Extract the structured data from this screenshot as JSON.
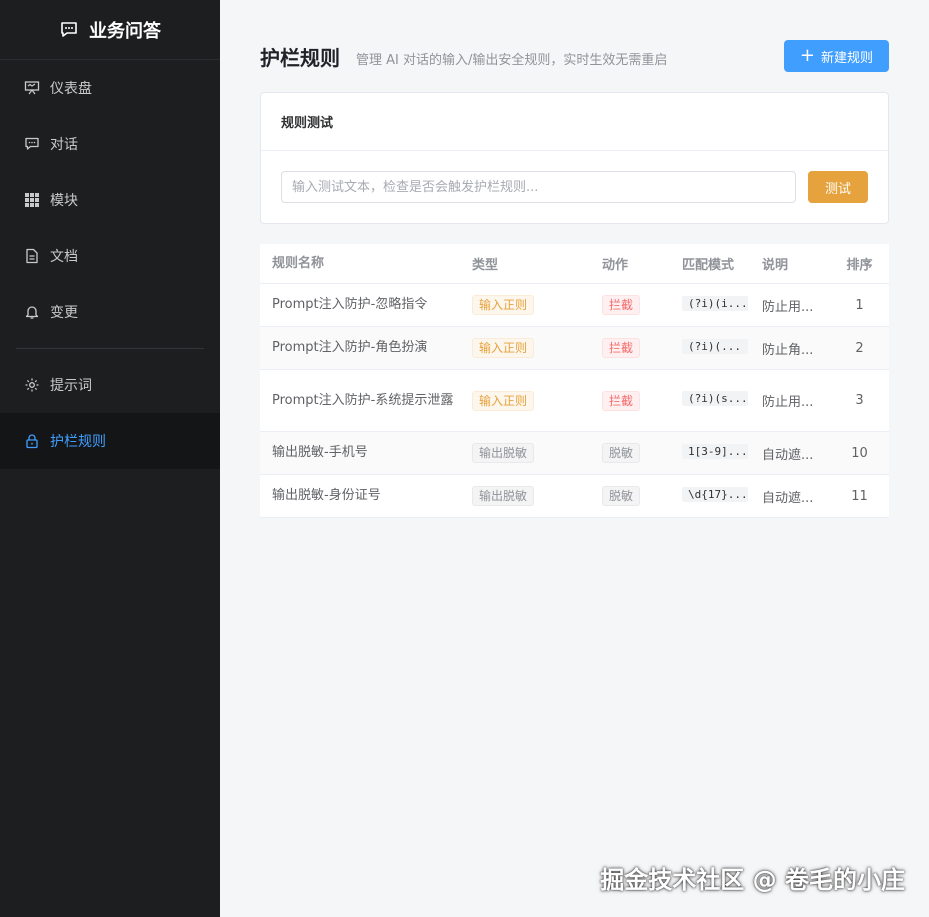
{
  "brand": {
    "title": "业务问答",
    "icon": "chat-icon"
  },
  "sidebar": {
    "items": [
      {
        "label": "仪表盘",
        "icon": "presentation-icon"
      },
      {
        "label": "对话",
        "icon": "chat-icon"
      },
      {
        "label": "模块",
        "icon": "grid-icon"
      },
      {
        "label": "文档",
        "icon": "document-icon"
      },
      {
        "label": "变更",
        "icon": "bell-icon"
      },
      {
        "label": "提示词",
        "icon": "gear-icon"
      },
      {
        "label": "护栏规则",
        "icon": "lock-icon",
        "active": true
      }
    ]
  },
  "page": {
    "title": "护栏规则",
    "description": "管理 AI 对话的输入/输出安全规则，实时生效无需重启",
    "new_button": "新建规则"
  },
  "test_card": {
    "title": "规则测试",
    "placeholder": "输入测试文本，检查是否会触发护栏规则...",
    "button": "测试"
  },
  "table": {
    "headers": [
      "规则名称",
      "类型",
      "动作",
      "匹配模式",
      "说明",
      "排序"
    ],
    "rows": [
      {
        "name": "Prompt注入防护-忽略指令",
        "type": "输入正则",
        "action": "拦截",
        "pattern": "(?i)(i...",
        "desc": "防止用...",
        "order": "1"
      },
      {
        "name": "Prompt注入防护-角色扮演",
        "type": "输入正则",
        "action": "拦截",
        "pattern": "(?i)(...",
        "desc": "防止角...",
        "order": "2"
      },
      {
        "name": "Prompt注入防护-系统提示泄露",
        "type": "输入正则",
        "action": "拦截",
        "pattern": "(?i)(s...",
        "desc": "防止用...",
        "order": "3"
      },
      {
        "name": "输出脱敏-手机号",
        "type": "输出脱敏",
        "action": "脱敏",
        "pattern": "1[3-9]...",
        "desc": "自动遮...",
        "order": "10"
      },
      {
        "name": "输出脱敏-身份证号",
        "type": "输出脱敏",
        "action": "脱敏",
        "pattern": "\\d{17}...",
        "desc": "自动遮...",
        "order": "11"
      }
    ]
  },
  "watermark": "掘金技术社区 @ 卷毛的小庄",
  "colors": {
    "primary": "#409eff",
    "warning": "#e6a23c",
    "danger": "#f56c6c",
    "sidebar": "#1d1e20"
  }
}
